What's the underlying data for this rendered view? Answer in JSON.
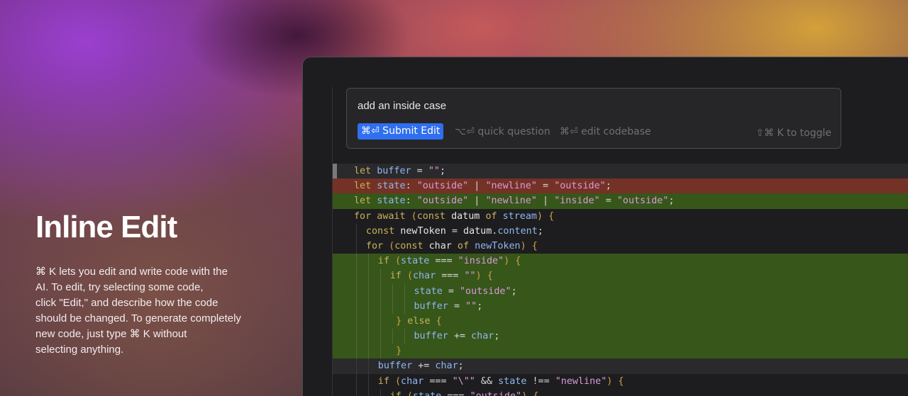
{
  "hero": {
    "title": "Inline Edit",
    "description_lines": [
      "⌘ K lets you edit and write code with the",
      "AI. To edit, try selecting some code,",
      "click \"Edit,\" and describe how the code",
      "should be changed. To generate completely",
      "new code, just type ⌘ K without",
      "selecting anything."
    ]
  },
  "prompt": {
    "input_value": "add an inside case",
    "submit_label": "⌘⏎ Submit Edit",
    "quick_question_hint": "⌥⏎ quick question",
    "edit_codebase_hint": "⌘⏎ edit codebase",
    "toggle_hint": "⇧⌘ K to toggle"
  },
  "code": {
    "line1": [
      [
        "kw",
        "let "
      ],
      [
        "nm",
        "buffer"
      ],
      [
        "op",
        " = "
      ],
      [
        "st",
        "\"\""
      ],
      [
        "op",
        ";"
      ]
    ],
    "line2": [
      [
        "kw",
        "let "
      ],
      [
        "nm",
        "state"
      ],
      [
        "op",
        ": "
      ],
      [
        "st",
        "\"outside\""
      ],
      [
        "op",
        " | "
      ],
      [
        "st",
        "\"newline\""
      ],
      [
        "op",
        " = "
      ],
      [
        "st",
        "\"outside\""
      ],
      [
        "op",
        ";"
      ]
    ],
    "line3": [
      [
        "kw",
        "let "
      ],
      [
        "nm",
        "state"
      ],
      [
        "op",
        ": "
      ],
      [
        "st",
        "\"outside\""
      ],
      [
        "op",
        " | "
      ],
      [
        "st",
        "\"newline\""
      ],
      [
        "op",
        " | "
      ],
      [
        "st",
        "\"inside\""
      ],
      [
        "op",
        " = "
      ],
      [
        "st",
        "\"outside\""
      ],
      [
        "op",
        ";"
      ]
    ],
    "line4": [
      [
        "kw",
        "for await "
      ],
      [
        "pu",
        "("
      ],
      [
        "kw",
        "const "
      ],
      [
        "pl",
        "datum "
      ],
      [
        "kw",
        "of "
      ],
      [
        "nm",
        "stream"
      ],
      [
        "pu",
        ") {"
      ]
    ],
    "line5": [
      [
        "kw",
        "const "
      ],
      [
        "pl",
        "newToken "
      ],
      [
        "op",
        "= "
      ],
      [
        "pl",
        "datum"
      ],
      [
        "op",
        "."
      ],
      [
        "nm",
        "content"
      ],
      [
        "op",
        ";"
      ]
    ],
    "line6": [
      [
        "kw",
        "for "
      ],
      [
        "pu",
        "("
      ],
      [
        "kw",
        "const "
      ],
      [
        "pl",
        "char "
      ],
      [
        "kw",
        "of "
      ],
      [
        "nm",
        "newToken"
      ],
      [
        "pu",
        ") {"
      ]
    ],
    "line7": [
      [
        "kw",
        "if "
      ],
      [
        "pu",
        "("
      ],
      [
        "nm",
        "state "
      ],
      [
        "op",
        "=== "
      ],
      [
        "st",
        "\"inside\""
      ],
      [
        "pu",
        ") {"
      ]
    ],
    "line8": [
      [
        "kw",
        "if "
      ],
      [
        "pu",
        "("
      ],
      [
        "nm",
        "char "
      ],
      [
        "op",
        "=== "
      ],
      [
        "st",
        "\"\""
      ],
      [
        "pu",
        ") {"
      ]
    ],
    "line9": [
      [
        "nm",
        "state "
      ],
      [
        "op",
        "= "
      ],
      [
        "st",
        "\"outside\""
      ],
      [
        "op",
        ";"
      ]
    ],
    "line10": [
      [
        "nm",
        "buffer "
      ],
      [
        "op",
        "= "
      ],
      [
        "st",
        "\"\""
      ],
      [
        "op",
        ";"
      ]
    ],
    "line11": [
      [
        "pu",
        "} "
      ],
      [
        "kw",
        "else "
      ],
      [
        "pu",
        "{"
      ]
    ],
    "line12": [
      [
        "nm",
        "buffer "
      ],
      [
        "op",
        "+= "
      ],
      [
        "nm",
        "char"
      ],
      [
        "op",
        ";"
      ]
    ],
    "line13": [
      [
        "pu",
        "}"
      ]
    ],
    "line14": [
      [
        "nm",
        "buffer "
      ],
      [
        "op",
        "+= "
      ],
      [
        "nm",
        "char"
      ],
      [
        "op",
        ";"
      ]
    ],
    "line15": [
      [
        "kw",
        "if "
      ],
      [
        "pu",
        "("
      ],
      [
        "nm",
        "char "
      ],
      [
        "op",
        "=== "
      ],
      [
        "st",
        "\"\\\"\""
      ],
      [
        "op",
        " && "
      ],
      [
        "nm",
        "state "
      ],
      [
        "op",
        "!== "
      ],
      [
        "st",
        "\"newline\""
      ],
      [
        "pu",
        ") {"
      ]
    ],
    "line16": [
      [
        "kw",
        "if "
      ],
      [
        "pu",
        "("
      ],
      [
        "nm",
        "state "
      ],
      [
        "op",
        "=== "
      ],
      [
        "st",
        "\"outside\""
      ],
      [
        "pu",
        ") {"
      ]
    ]
  },
  "colors": {
    "accent": "#2f6ff0",
    "added_line": "#37561a",
    "removed_line": "#743226",
    "editor_bg": "#1d1d1f"
  }
}
